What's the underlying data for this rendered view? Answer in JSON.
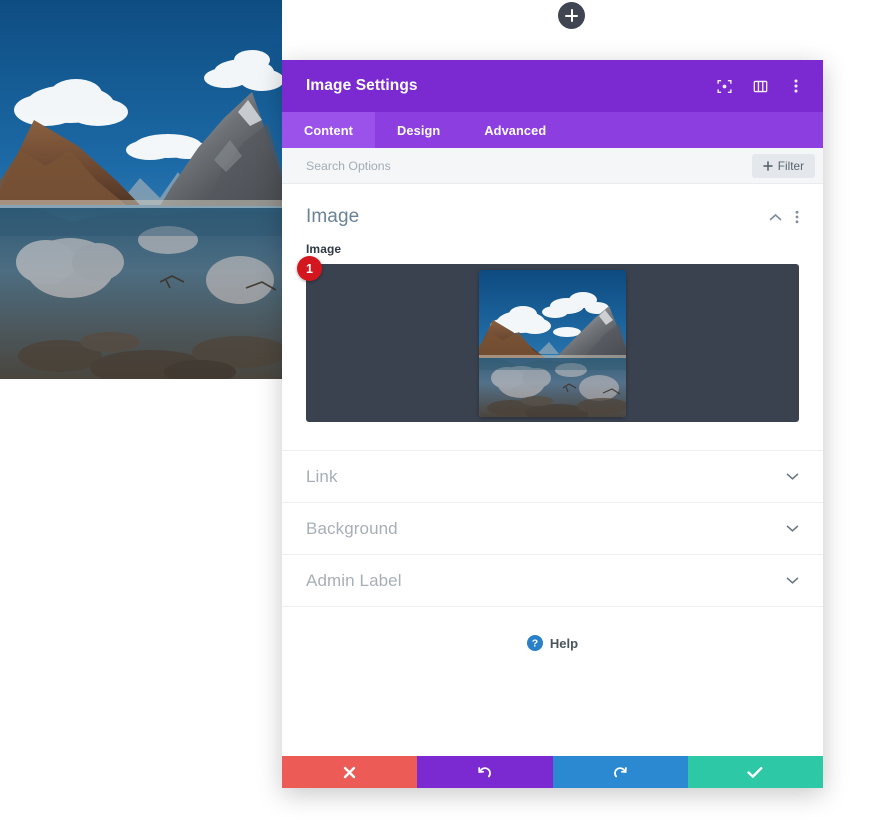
{
  "canvas": {
    "add_module_button": "+",
    "hero_image_alt": "mountain-lake-landscape"
  },
  "modal": {
    "title": "Image Settings",
    "header_icons": [
      {
        "name": "focus-icon",
        "label": "Focus"
      },
      {
        "name": "layout-panel-icon",
        "label": "Layout"
      },
      {
        "name": "more-vertical-icon",
        "label": "More"
      }
    ],
    "tabs": [
      {
        "label": "Content",
        "active": true
      },
      {
        "label": "Design",
        "active": false
      },
      {
        "label": "Advanced",
        "active": false
      }
    ],
    "search": {
      "value": "",
      "placeholder": "Search Options"
    },
    "filter_label": "Filter",
    "sections": {
      "image": {
        "title": "Image",
        "field_label": "Image",
        "badge": "1",
        "upload_bg_color": "#3a4250"
      },
      "collapsed": [
        {
          "title": "Link"
        },
        {
          "title": "Background"
        },
        {
          "title": "Admin Label"
        }
      ]
    },
    "help": {
      "label": "Help"
    },
    "footer": [
      {
        "name": "cancel-button",
        "icon": "close-icon",
        "color": "#ec5b55"
      },
      {
        "name": "undo-button",
        "icon": "undo-icon",
        "color": "#7b2ad1"
      },
      {
        "name": "redo-button",
        "icon": "redo-icon",
        "color": "#2a89d1"
      },
      {
        "name": "save-button",
        "icon": "checkmark-icon",
        "color": "#2dc9a6"
      }
    ]
  },
  "colors": {
    "header_purple": "#7b2ad1",
    "tabbar_purple": "#8d3ee0",
    "active_tab_purple": "#9b52ea",
    "badge_red": "#d4161e",
    "save_green": "#2dc9a6",
    "cancel_red": "#ec5b55",
    "redo_blue": "#2a89d1"
  }
}
